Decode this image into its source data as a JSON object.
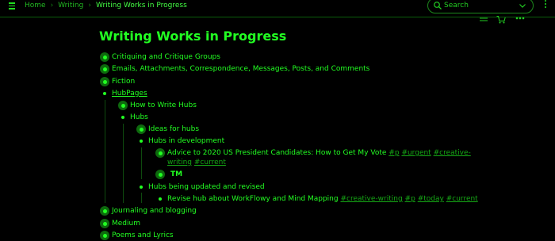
{
  "breadcrumbs": {
    "home": "Home",
    "writing": "Writing",
    "current": "Writing Works in Progress"
  },
  "search": {
    "placeholder": "Search"
  },
  "page": {
    "title": "Writing Works in Progress"
  },
  "outline": {
    "critiquing": "Critiquing and Critique Groups",
    "emails": "Emails, Attachments, Correspondence, Messages, Posts, and Comments",
    "fiction": "Fiction",
    "hubpages": "HubPages",
    "how_to_write": "How to Write Hubs",
    "hubs": "Hubs",
    "ideas": "Ideas for hubs",
    "in_dev": "Hubs in development",
    "advice": "Advice to 2020 US President Candidates: How to Get My Vote",
    "advice_tags": [
      "#p",
      "#urgent",
      "#creative-",
      "writing",
      "#current"
    ],
    "tm": "TM",
    "updated": "Hubs being updated and revised",
    "revise": "Revise hub about WorkFlowy and Mind Mapping",
    "revise_tags": [
      "#creative-writing",
      "#p",
      "#today",
      "#current"
    ],
    "journaling": "Journaling and blogging",
    "medium": "Medium",
    "poems": "Poems and Lyrics"
  },
  "colors": {
    "background": "#000000",
    "accent": "#22ff22",
    "tag": "#15a815",
    "guide": "#0e4a0e"
  }
}
